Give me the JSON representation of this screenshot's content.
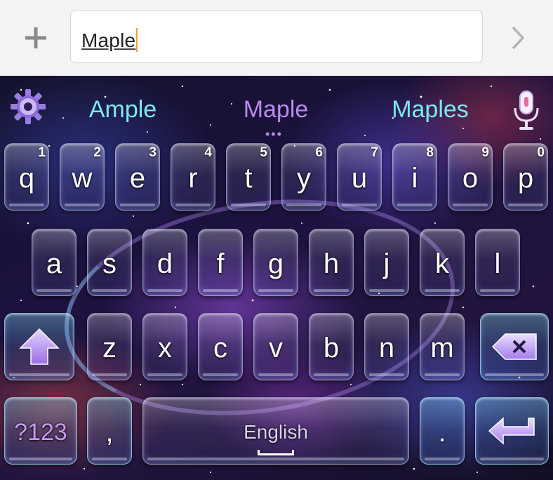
{
  "input_bar": {
    "add_icon": "plus-icon",
    "text": "Maple",
    "next_icon": "chevron-right-icon"
  },
  "keyboard": {
    "theme": "galaxy",
    "settings_icon": "gear-icon",
    "mic_icon": "microphone-icon",
    "suggestions": [
      "Ample",
      "Maple",
      "Maples"
    ],
    "suggestion_more": "•••",
    "rows": [
      [
        {
          "letter": "q",
          "hint": "1"
        },
        {
          "letter": "w",
          "hint": "2"
        },
        {
          "letter": "e",
          "hint": "3"
        },
        {
          "letter": "r",
          "hint": "4"
        },
        {
          "letter": "t",
          "hint": "5"
        },
        {
          "letter": "y",
          "hint": "6"
        },
        {
          "letter": "u",
          "hint": "7"
        },
        {
          "letter": "i",
          "hint": "8"
        },
        {
          "letter": "o",
          "hint": "9"
        },
        {
          "letter": "p",
          "hint": "0"
        }
      ],
      [
        {
          "letter": "a"
        },
        {
          "letter": "s"
        },
        {
          "letter": "d"
        },
        {
          "letter": "f"
        },
        {
          "letter": "g"
        },
        {
          "letter": "h"
        },
        {
          "letter": "j"
        },
        {
          "letter": "k"
        },
        {
          "letter": "l"
        }
      ],
      [
        {
          "letter": "z"
        },
        {
          "letter": "x"
        },
        {
          "letter": "c"
        },
        {
          "letter": "v"
        },
        {
          "letter": "b"
        },
        {
          "letter": "n"
        },
        {
          "letter": "m"
        }
      ]
    ],
    "shift_icon": "shift-arrow-icon",
    "backspace_icon": "backspace-icon",
    "symbols_label": "?123",
    "comma_label": ",",
    "space_label": "English",
    "period_label": ".",
    "enter_icon": "enter-arrow-icon"
  }
}
